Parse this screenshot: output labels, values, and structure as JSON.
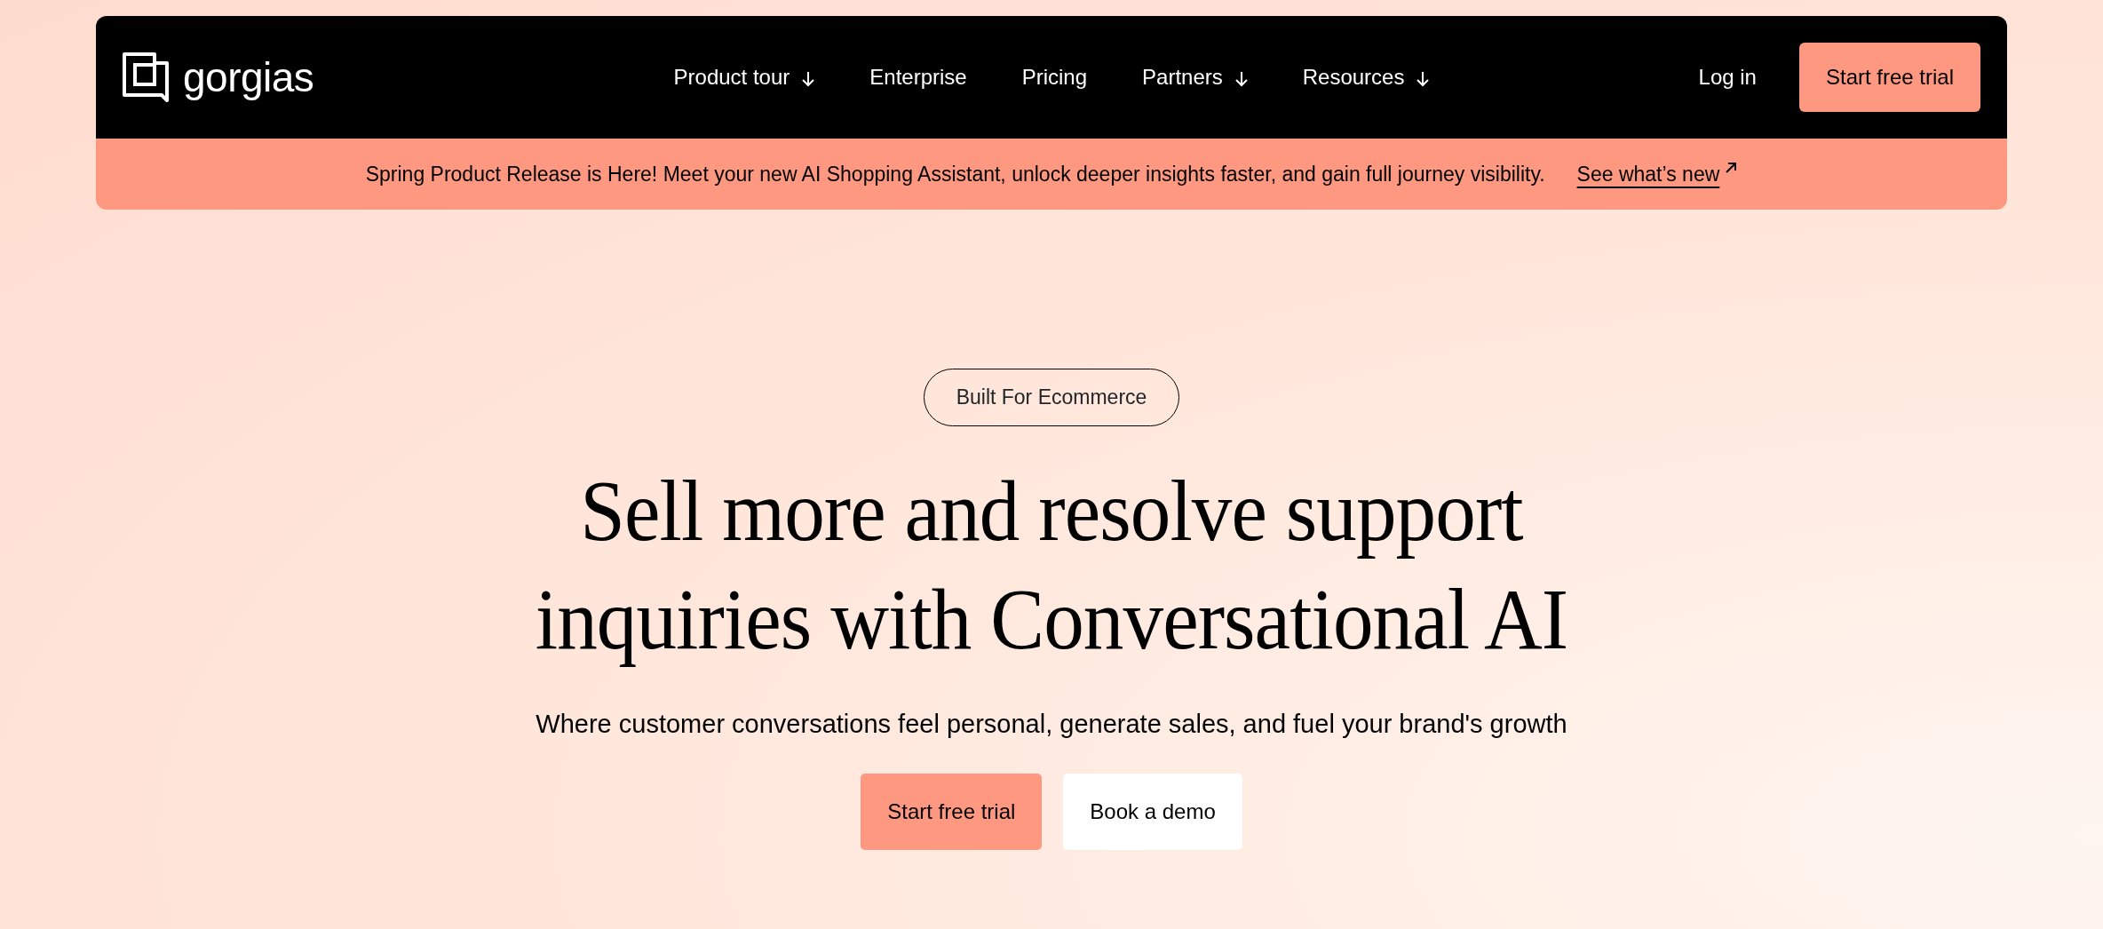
{
  "navbar": {
    "logo": "gorgias",
    "items": [
      {
        "label": "Product tour",
        "has_menu": true
      },
      {
        "label": "Enterprise",
        "has_menu": false
      },
      {
        "label": "Pricing",
        "has_menu": false
      },
      {
        "label": "Partners",
        "has_menu": true
      },
      {
        "label": "Resources",
        "has_menu": true
      }
    ],
    "login": "Log in",
    "cta": "Start free trial"
  },
  "announcement": {
    "text": "Spring Product Release is Here! Meet your new AI Shopping Assistant, unlock deeper insights faster, and gain full journey visibility.",
    "link": "See what’s new"
  },
  "hero": {
    "tag": "Built For Ecommerce",
    "title": "Sell more and resolve support inquiries with Conversational AI",
    "subtitle": "Where customer conversations feel personal, generate sales, and fuel your brand's growth",
    "buttons": [
      {
        "label": "Start free trial",
        "kind": "primary"
      },
      {
        "label": "Book a demo",
        "kind": "secondary"
      }
    ]
  }
}
